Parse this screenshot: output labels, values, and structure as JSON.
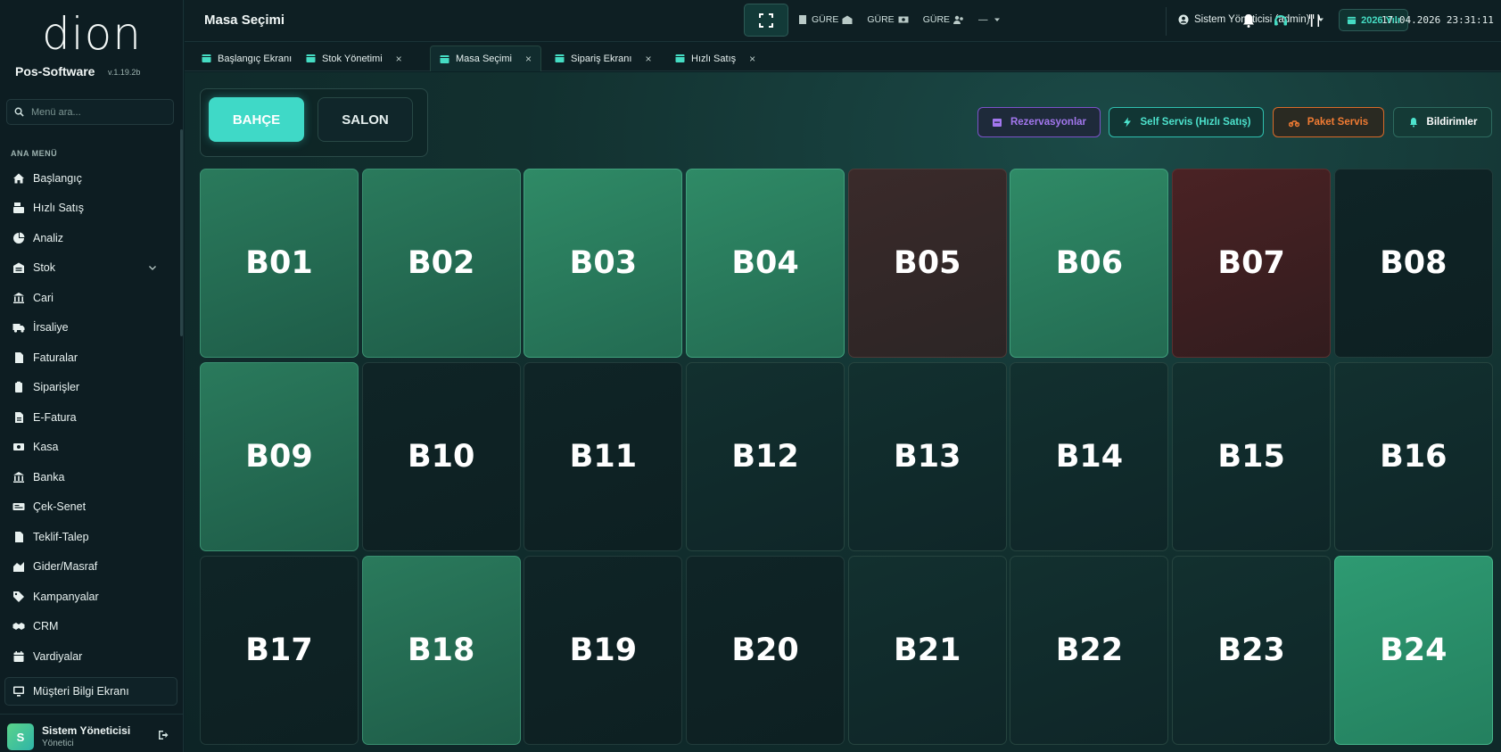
{
  "sidebar": {
    "logo": "dion",
    "brand": "Pos-Software",
    "version": "v.1.19.2b",
    "search_placeholder": "Menü ara...",
    "section_label": "ANA MENÜ",
    "items": [
      {
        "label": "Başlangıç",
        "icon": "home-icon"
      },
      {
        "label": "Hızlı Satış",
        "icon": "cash-register-icon"
      },
      {
        "label": "Analiz",
        "icon": "pie-chart-icon"
      },
      {
        "label": "Stok",
        "icon": "warehouse-icon"
      },
      {
        "label": "Cari",
        "icon": "bank-icon"
      },
      {
        "label": "İrsaliye",
        "icon": "truck-icon"
      },
      {
        "label": "Faturalar",
        "icon": "invoice-icon"
      },
      {
        "label": "Siparişler",
        "icon": "order-icon"
      },
      {
        "label": "E-Fatura",
        "icon": "e-invoice-icon"
      },
      {
        "label": "Kasa",
        "icon": "cash-icon"
      },
      {
        "label": "Banka",
        "icon": "bank-icon"
      },
      {
        "label": "Çek-Senet",
        "icon": "cheque-icon"
      },
      {
        "label": "Teklif-Talep",
        "icon": "document-icon"
      },
      {
        "label": "Gider/Masraf",
        "icon": "expense-icon"
      },
      {
        "label": "Kampanyalar",
        "icon": "tag-icon"
      },
      {
        "label": "CRM",
        "icon": "handshake-icon"
      },
      {
        "label": "Vardiyalar",
        "icon": "calendar-icon"
      }
    ],
    "customer_screen": "Müşteri Bilgi Ekranı",
    "user": {
      "initial": "S",
      "name": "Sistem Yöneticisi",
      "role": "Yönetici"
    }
  },
  "topbar": {
    "title": "Masa Seçimi",
    "info_1": "GÜRE",
    "info_2": "GÜRE",
    "info_3": "GÜRE",
    "info_4": "—",
    "user": "Sistem Yöneticisi (admin)",
    "year": "2026 Yılı",
    "datetime": "17.04.2026 23:31:11"
  },
  "tabs": [
    {
      "label": "Başlangıç Ekranı",
      "closable": false
    },
    {
      "label": "Stok Yönetimi",
      "closable": true
    },
    {
      "label": "Masa Seçimi",
      "closable": true,
      "active": true
    },
    {
      "label": "Sipariş Ekranı",
      "closable": true
    },
    {
      "label": "Hızlı Satış",
      "closable": true
    }
  ],
  "close_glyph": "×",
  "areas": {
    "active": "BAHÇE",
    "other": "SALON"
  },
  "actions": {
    "reservations": "Rezervasyonlar",
    "self_service": "Self Servis (Hızlı Satış)",
    "package": "Paket Servis",
    "notifications": "Bildirimler"
  },
  "colors": {
    "accent": "#3fd9c7",
    "occupied": "#2a7a5c",
    "bill": "#4a2224",
    "empty": "#0f2426"
  },
  "tables": [
    {
      "name": "B01",
      "status": "occupied"
    },
    {
      "name": "B02",
      "status": "occupied"
    },
    {
      "name": "B03",
      "status": "occupied"
    },
    {
      "name": "B04",
      "status": "occupied"
    },
    {
      "name": "B05",
      "status": "bill"
    },
    {
      "name": "B06",
      "status": "occupied"
    },
    {
      "name": "B07",
      "status": "bill"
    },
    {
      "name": "B08",
      "status": "empty"
    },
    {
      "name": "B09",
      "status": "occupied"
    },
    {
      "name": "B10",
      "status": "empty"
    },
    {
      "name": "B11",
      "status": "empty"
    },
    {
      "name": "B12",
      "status": "empty"
    },
    {
      "name": "B13",
      "status": "empty"
    },
    {
      "name": "B14",
      "status": "empty"
    },
    {
      "name": "B15",
      "status": "empty"
    },
    {
      "name": "B16",
      "status": "empty"
    },
    {
      "name": "B17",
      "status": "empty"
    },
    {
      "name": "B18",
      "status": "occupied"
    },
    {
      "name": "B19",
      "status": "empty"
    },
    {
      "name": "B20",
      "status": "empty"
    },
    {
      "name": "B21",
      "status": "empty"
    },
    {
      "name": "B22",
      "status": "empty"
    },
    {
      "name": "B23",
      "status": "empty"
    },
    {
      "name": "B24",
      "status": "occupied"
    }
  ]
}
